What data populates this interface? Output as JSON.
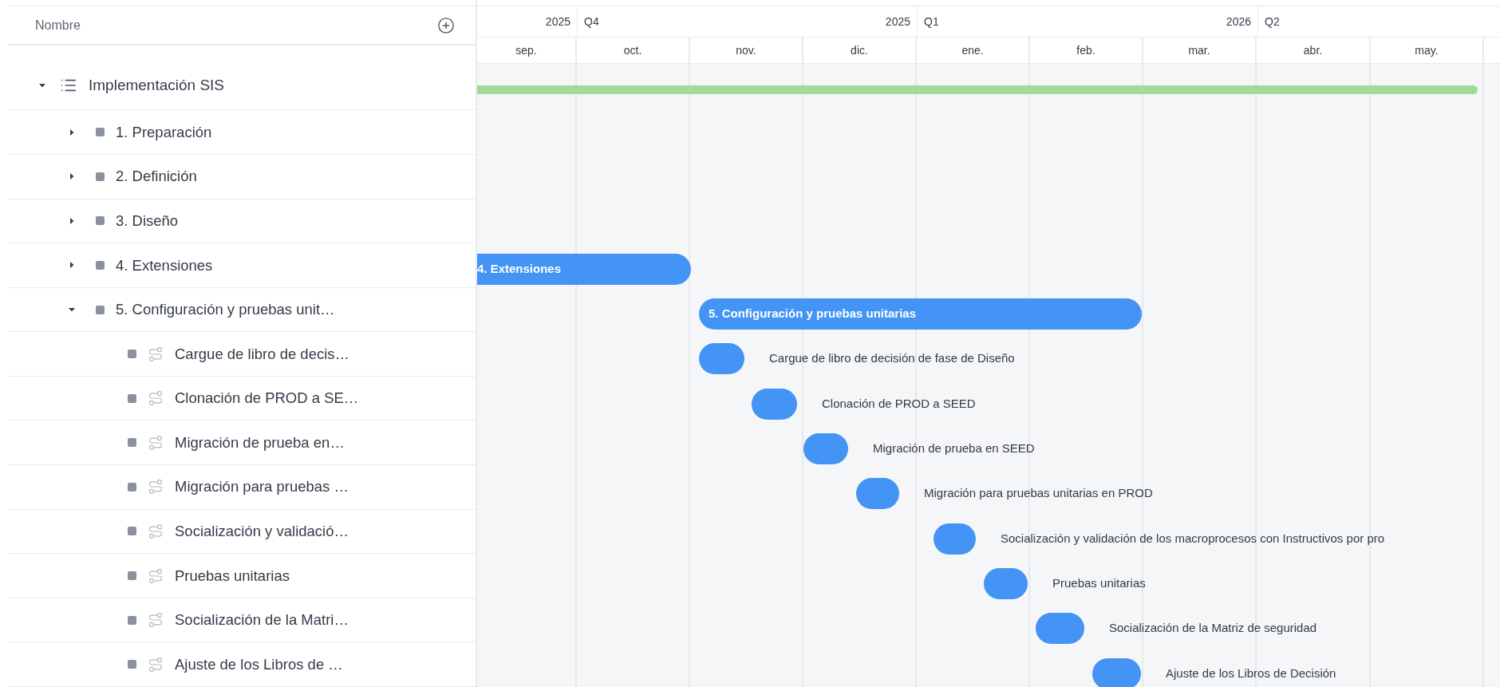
{
  "header": {
    "name_column": "Nombre"
  },
  "timeline": {
    "quarters": [
      {
        "year": "2025",
        "quarter": "Q4"
      },
      {
        "year": "2025",
        "quarter": "Q1"
      },
      {
        "year": "2026",
        "quarter": "Q2"
      }
    ],
    "months": [
      "sep.",
      "oct.",
      "nov.",
      "dic.",
      "ene.",
      "feb.",
      "mar.",
      "abr.",
      "may."
    ]
  },
  "tree": [
    {
      "label": "Implementación SIS",
      "kind": "project",
      "expanded": true,
      "bar": {
        "color": "#a0dc96"
      },
      "children": [
        {
          "label": "1. Preparación",
          "kind": "phase",
          "expanded": false
        },
        {
          "label": "2. Definición",
          "kind": "phase",
          "expanded": false
        },
        {
          "label": "3. Diseño",
          "kind": "phase",
          "expanded": false
        },
        {
          "label": "4. Extensiones",
          "kind": "phase",
          "expanded": false,
          "bar": {
            "label": "4. Extensiones",
            "color": "#4394f4"
          }
        },
        {
          "label": "5. Configuración y pruebas unit…",
          "kind": "phase",
          "expanded": true,
          "bar": {
            "label": "5. Configuración y pruebas unitarias",
            "color": "#4394f4"
          },
          "children": [
            {
              "label": "Cargue de libro de decis…",
              "kind": "task",
              "bar": {
                "label": "Cargue de libro de decisión de fase de Diseño",
                "color": "#4394f4"
              }
            },
            {
              "label": "Clonación de PROD a SE…",
              "kind": "task",
              "bar": {
                "label": "Clonación de PROD a SEED",
                "color": "#4394f4"
              }
            },
            {
              "label": "Migración de prueba en…",
              "kind": "task",
              "bar": {
                "label": "Migración de prueba en SEED",
                "color": "#4394f4"
              }
            },
            {
              "label": "Migración para pruebas …",
              "kind": "task",
              "bar": {
                "label": "Migración para pruebas unitarias en PROD",
                "color": "#4394f4"
              }
            },
            {
              "label": "Socialización y validació…",
              "kind": "task",
              "bar": {
                "label": "Socialización y validación de los macroprocesos con Instructivos por pro",
                "color": "#4394f4"
              }
            },
            {
              "label": "Pruebas unitarias",
              "kind": "task",
              "bar": {
                "label": "Pruebas unitarias",
                "color": "#4394f4"
              }
            },
            {
              "label": "Socialización de la Matri…",
              "kind": "task",
              "bar": {
                "label": "Socialización de la Matriz de seguridad",
                "color": "#4394f4"
              }
            },
            {
              "label": "Ajuste de los Libros de …",
              "kind": "task",
              "bar": {
                "label": "Ajuste de los Libros de Decisión",
                "color": "#4394f4"
              }
            }
          ]
        }
      ]
    }
  ]
}
